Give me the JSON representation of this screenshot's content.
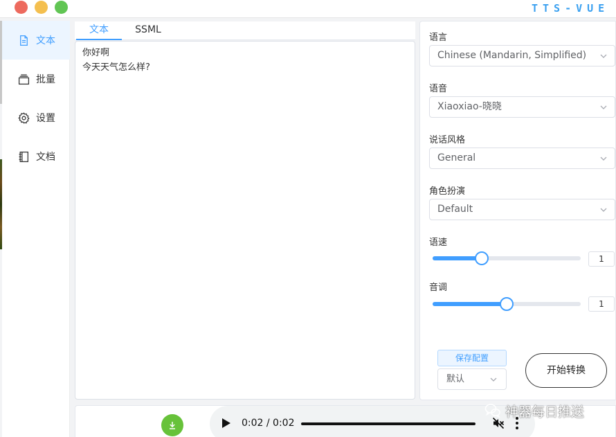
{
  "colors": {
    "accent": "#409eff",
    "close": "#ed6a5e",
    "minimize": "#f4bf4f",
    "maximize": "#61c554",
    "brand_bg": "#ffffff",
    "brand_text": "#3aa0f0",
    "download": "#67c23a"
  },
  "titlebar": {
    "brand": "TTS-VUE"
  },
  "sidebar": {
    "items": [
      {
        "label": "文本",
        "icon": "document-icon",
        "active": true
      },
      {
        "label": "批量",
        "icon": "stack-icon",
        "active": false
      },
      {
        "label": "设置",
        "icon": "gear-icon",
        "active": false
      },
      {
        "label": "文档",
        "icon": "notebook-icon",
        "active": false
      }
    ]
  },
  "editor": {
    "tabs": [
      {
        "label": "文本",
        "active": true
      },
      {
        "label": "SSML",
        "active": false
      }
    ],
    "lines": [
      "你好啊",
      "今天天气怎么样?"
    ]
  },
  "options": {
    "language": {
      "label": "语言",
      "value": "Chinese (Mandarin, Simplified)"
    },
    "voice": {
      "label": "语音",
      "value": "Xiaoxiao-晓晓"
    },
    "style": {
      "label": "说话风格",
      "value": "General"
    },
    "role": {
      "label": "角色扮演",
      "value": "Default"
    },
    "rate": {
      "label": "语速",
      "value": "1",
      "fraction": 0.33
    },
    "pitch": {
      "label": "音调",
      "value": "1",
      "fraction": 0.5
    },
    "save_config_label": "保存配置",
    "preset_value": "默认",
    "start_label": "开始转换"
  },
  "player": {
    "time": "0:02 / 0:02",
    "progress": 1.0
  },
  "watermark": {
    "text": "神器每日推送",
    "icon": "wechat-icon"
  }
}
